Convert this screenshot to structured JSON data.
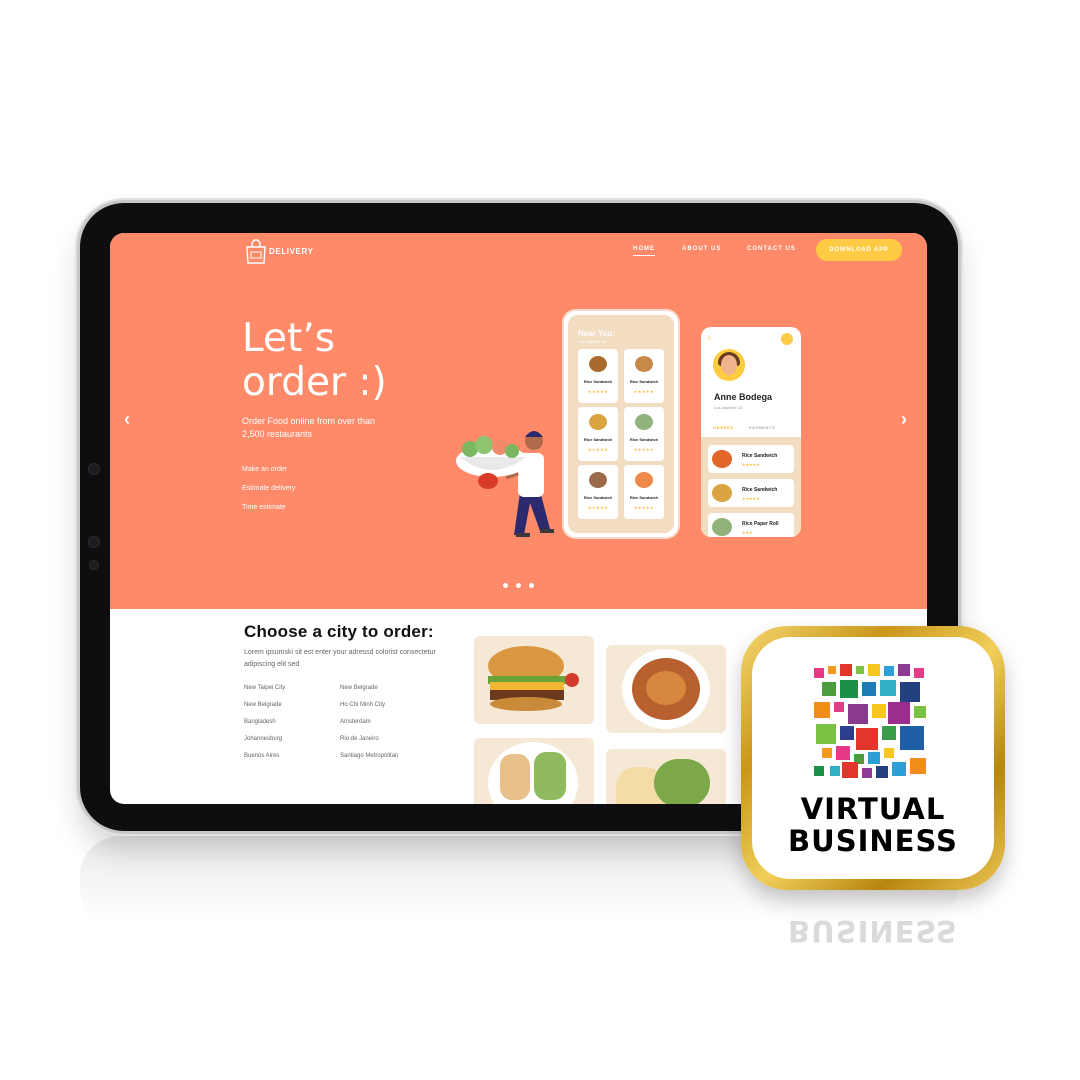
{
  "nav": {
    "brand": "DELIVERY",
    "links": [
      "HOME",
      "ABOUT US",
      "CONTACT US"
    ],
    "download_label": "DOWNLOAD APP"
  },
  "hero": {
    "title": "Let’s\norder :)",
    "subtitle": "Order Food online from over than 2,500 restaurants",
    "links": [
      "Make an order",
      "Estimate delivery",
      "Time estimate"
    ],
    "slide_count": 3
  },
  "phone_menu": {
    "title": "Near You:",
    "subtitle": "Los Angeles CA",
    "items": [
      {
        "name": "Rice Sandwich",
        "rating": "★★★★★"
      },
      {
        "name": "Rice Sandwich",
        "rating": "★★★★★"
      },
      {
        "name": "Rice Sandwich",
        "rating": "★★★★★"
      },
      {
        "name": "Rice Sandwich",
        "rating": "★★★★★"
      },
      {
        "name": "Rice Sandwich",
        "rating": "★★★★★"
      },
      {
        "name": "Rice Sandwich",
        "rating": "★★★★★"
      }
    ]
  },
  "phone_profile": {
    "name": "Anne Bodega",
    "location": "Los Angeles CA",
    "tabs": [
      "ORDERS",
      "PAYMENTS"
    ],
    "orders": [
      {
        "name": "Rice Sandwich",
        "rating": "★★★★★"
      },
      {
        "name": "Rice Sandwich",
        "rating": "★★★★★"
      },
      {
        "name": "Rice Paper Roll",
        "rating": "★★★"
      }
    ]
  },
  "cities_section": {
    "title": "Choose a city to order:",
    "description": "Lorem ipsumski sit est enter your adressd colorist consectetur adipiscing elit sed",
    "cities_col1": [
      "New Taipei City",
      "New Belgrade",
      "Bangladesh",
      "Johannesburg",
      "Buenos Aires"
    ],
    "cities_col2": [
      "New Belgrade",
      "Ho Chi Minh City",
      "Amsterdam",
      "Rio de Janeiro",
      "Santiago Metropolitan"
    ]
  },
  "badge": {
    "line1": "VIRTUAL",
    "line2": "BUSINESS"
  },
  "colors": {
    "hero_bg": "#ff8a6a",
    "accent": "#ffcb45",
    "card_bg": "#f5e8d4"
  }
}
